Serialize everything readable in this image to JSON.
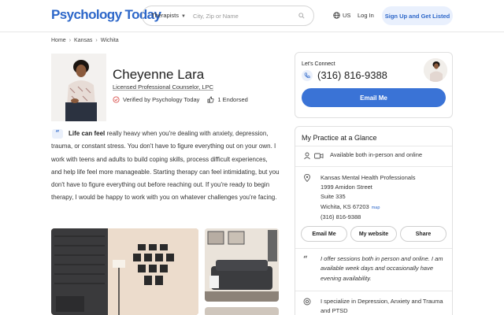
{
  "header": {
    "logo": "Psychology Today",
    "search_select": "Therapists",
    "search_placeholder": "City, Zip or Name",
    "lang": "US",
    "login": "Log In",
    "signup": "Sign Up and Get Listed"
  },
  "breadcrumb": [
    "Home",
    "Kansas",
    "Wichita"
  ],
  "profile": {
    "name": "Cheyenne Lara",
    "title": "Licensed Professional Counselor, LPC",
    "verified": "Verified by Psychology Today",
    "endorsed": "1 Endorsed"
  },
  "bio": {
    "lead": "Life can feel",
    "text": " really heavy when you're dealing with anxiety, depression, trauma, or constant stress. You don't have to figure everything out on your own. I work with teens and adults to build coping skills, process difficult experiences, and help life feel more manageable. Starting therapy can feel intimidating, but you don't have to figure everything out before reaching out. If you're ready to begin therapy, I would be happy to work with you on whatever challenges you're facing."
  },
  "connect": {
    "label": "Let's Connect",
    "phone": "(316) 816-9388",
    "email_button": "Email Me"
  },
  "practice": {
    "title": "My Practice at a Glance",
    "availability": "Available both in-person and online",
    "address_lines": [
      "Kansas Mental Health Professionals",
      "1999 Amidon Street",
      "Suite 335",
      "Wichita, KS 67203",
      "(316) 816-9388"
    ],
    "map_link": "map",
    "buttons": [
      "Email Me",
      "My website",
      "Share"
    ],
    "statement": "I offer sessions both in person and online. I am available week days and occasionally have evening availability.",
    "specialties": "I specialize in Depression, Anxiety and Trauma and PTSD"
  },
  "colors": {
    "brand": "#2d67c9",
    "email_button": "#3a73d6",
    "signup_bg": "#e9f0fd"
  }
}
